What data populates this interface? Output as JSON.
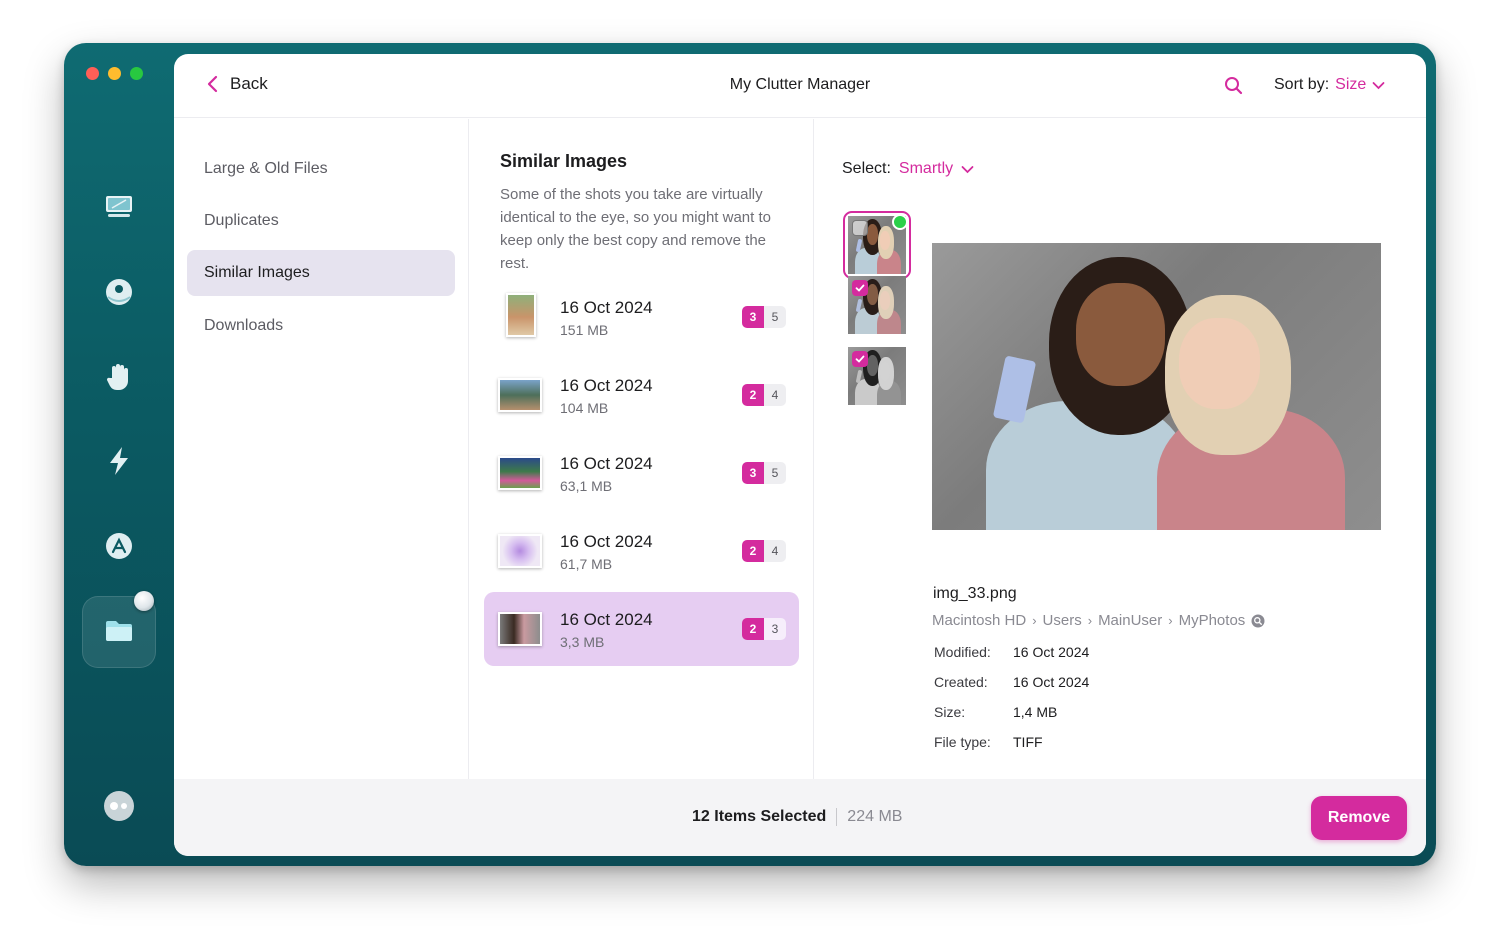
{
  "window": {
    "app_title": "My Clutter Manager"
  },
  "sidebar_icons": [
    "monitor-icon",
    "disk-icon",
    "hand-icon",
    "lightning-icon",
    "apps-icon",
    "folder-icon",
    "assistant-icon"
  ],
  "header": {
    "back_label": "Back",
    "title": "My Clutter Manager",
    "sort_label": "Sort by:",
    "sort_value": "Size"
  },
  "nav": {
    "items": [
      {
        "label": "Large & Old Files"
      },
      {
        "label": "Duplicates"
      },
      {
        "label": "Similar Images"
      },
      {
        "label": "Downloads"
      }
    ],
    "active": "Similar Images"
  },
  "middle": {
    "title": "Similar Images",
    "description": "Some of the shots you take are virtually identical to the eye, so you might want to keep only the best copy and remove the rest.",
    "groups": [
      {
        "date": "16 Oct 2024",
        "size": "151 MB",
        "selected": "3",
        "total": "5"
      },
      {
        "date": "16 Oct 2024",
        "size": "104 MB",
        "selected": "2",
        "total": "4"
      },
      {
        "date": "16 Oct 2024",
        "size": "63,1 MB",
        "selected": "3",
        "total": "5"
      },
      {
        "date": "16 Oct 2024",
        "size": "61,7 MB",
        "selected": "2",
        "total": "4"
      },
      {
        "date": "16 Oct 2024",
        "size": "3,3 MB",
        "selected": "2",
        "total": "3"
      }
    ]
  },
  "detail": {
    "select_label": "Select:",
    "select_value": "Smartly",
    "file_name": "img_33.png",
    "path": [
      "Macintosh HD",
      "Users",
      "MainUser",
      "MyPhotos"
    ],
    "meta": [
      {
        "key": "Modified:",
        "value": "16 Oct 2024"
      },
      {
        "key": "Created:",
        "value": "16 Oct 2024"
      },
      {
        "key": "Size:",
        "value": "1,4 MB"
      },
      {
        "key": "File type:",
        "value": "TIFF"
      }
    ]
  },
  "footer": {
    "selection_count": "12 Items Selected",
    "selection_size": "224 MB",
    "remove_label": "Remove"
  },
  "colors": {
    "accent": "#d42b9e",
    "sidebar": "#0b5a62",
    "active_group": "#e6cdf2",
    "active_nav": "#e6e3ef"
  }
}
